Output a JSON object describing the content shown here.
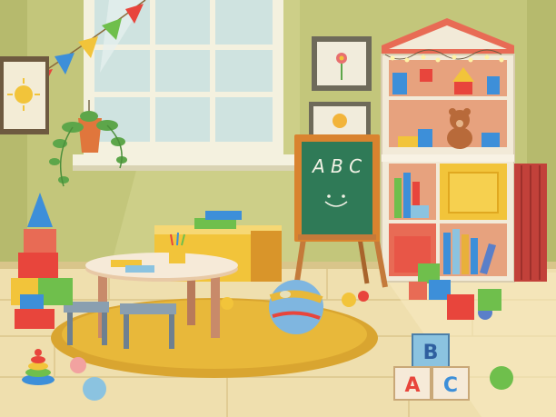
{
  "chalkboard": {
    "text": "A B C"
  },
  "blocks": {
    "top": "B",
    "left": "A",
    "right": "C"
  },
  "colors": {
    "wall": "#b9bd6e",
    "wall_light": "#cfd38a",
    "floor": "#efdfae",
    "rug": "#e8b83a",
    "chalkboard": "#2f7a57",
    "shelf": "#f2ead8"
  }
}
